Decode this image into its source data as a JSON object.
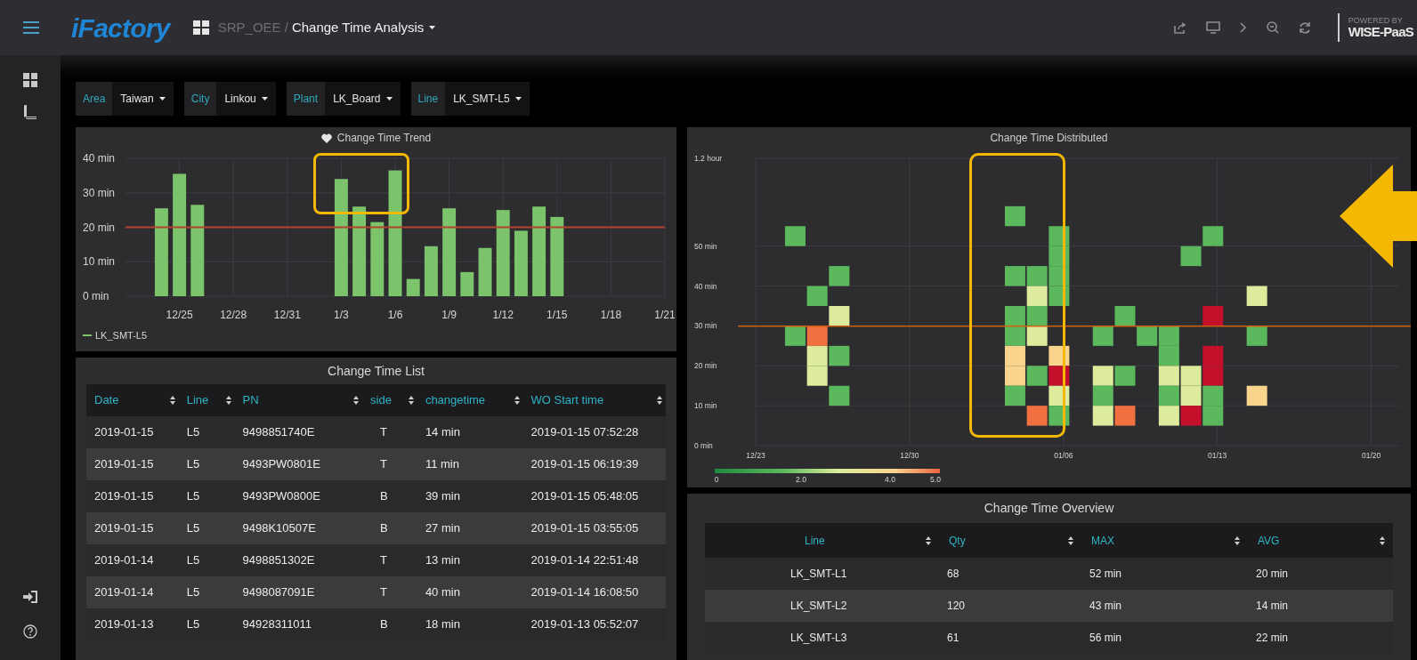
{
  "top_bar": {
    "logo": "iFactory",
    "breadcrumb_parent": "SRP_OEE /",
    "title": "Change Time Analysis",
    "powered_by": "POWERED BY",
    "brand": "WISE-PaaS"
  },
  "filters": [
    {
      "label": "Area",
      "value": "Taiwan"
    },
    {
      "label": "City",
      "value": "Linkou"
    },
    {
      "label": "Plant",
      "value": "LK_Board"
    },
    {
      "label": "Line",
      "value": "LK_SMT-L5"
    }
  ],
  "trend_panel": {
    "title": "Change Time Trend",
    "chart_data": {
      "type": "bar",
      "categories": [
        null,
        "12/25",
        null,
        null,
        "12/28",
        null,
        null,
        "12/31",
        null,
        null,
        "1/3",
        null,
        null,
        "1/6",
        null,
        null,
        "1/9",
        null,
        null,
        "1/12",
        null,
        null,
        "1/15",
        null,
        null,
        "1/18",
        null,
        null,
        "1/21"
      ],
      "series": [
        {
          "name": "LK_SMT-L5",
          "color": "#7cc46c",
          "values": [
            25.5,
            35.5,
            26.5,
            null,
            null,
            null,
            null,
            null,
            null,
            null,
            34,
            26,
            21.5,
            36.5,
            5,
            14.5,
            25.5,
            7,
            14,
            25,
            19,
            26,
            23,
            null,
            null,
            null,
            null,
            null,
            null
          ]
        }
      ],
      "ylim": [
        0,
        40
      ],
      "yticks": [
        {
          "value": 0,
          "label": "0 min"
        },
        {
          "value": 10,
          "label": "10 min"
        },
        {
          "value": 20,
          "label": "20 min"
        },
        {
          "value": 30,
          "label": "30 min"
        },
        {
          "value": 40,
          "label": "40 min"
        }
      ],
      "grid": true,
      "ref_lines": [
        {
          "axis": "y",
          "value": 20
        }
      ]
    }
  },
  "distribution_panel": {
    "title": "Change Time Distributed",
    "y_labels": [
      "1.2 hour",
      "50 min",
      "40 min",
      "30 min",
      "20 min",
      "10 min",
      "0 min"
    ],
    "x_labels": [
      "12/23",
      "12/30",
      "01/06",
      "01/13",
      "01/20"
    ],
    "scale_labels": [
      "0",
      "2.0",
      "4.0",
      "5.0"
    ]
  },
  "list_panel": {
    "title": "Change Time List",
    "columns": [
      "Date",
      "Line",
      "PN",
      "side",
      "changetime",
      "WO Start time"
    ],
    "rows": [
      [
        "2019-01-15",
        "L5",
        "9498851740E",
        "T",
        "14 min",
        "2019-01-15 07:52:28"
      ],
      [
        "2019-01-15",
        "L5",
        "9493PW0801E",
        "T",
        "11 min",
        "2019-01-15 06:19:39"
      ],
      [
        "2019-01-15",
        "L5",
        "9493PW0800E",
        "B",
        "39 min",
        "2019-01-15 05:48:05"
      ],
      [
        "2019-01-15",
        "L5",
        "9498K10507E",
        "B",
        "27 min",
        "2019-01-15 03:55:05"
      ],
      [
        "2019-01-14",
        "L5",
        "9498851302E",
        "T",
        "13 min",
        "2019-01-14 22:51:48"
      ],
      [
        "2019-01-14",
        "L5",
        "9498087091E",
        "T",
        "40 min",
        "2019-01-14 16:08:50"
      ],
      [
        "2019-01-13",
        "L5",
        "94928311011",
        "B",
        "18 min",
        "2019-01-13 05:52:07"
      ]
    ]
  },
  "overview_panel": {
    "title": "Change Time Overview",
    "columns": [
      "Line",
      "Qty",
      "MAX",
      "AVG"
    ],
    "rows": [
      [
        "LK_SMT-L1",
        "68",
        "52 min",
        "20 min"
      ],
      [
        "LK_SMT-L2",
        "120",
        "43 min",
        "14 min"
      ],
      [
        "LK_SMT-L3",
        "61",
        "56 min",
        "22 min"
      ]
    ]
  }
}
